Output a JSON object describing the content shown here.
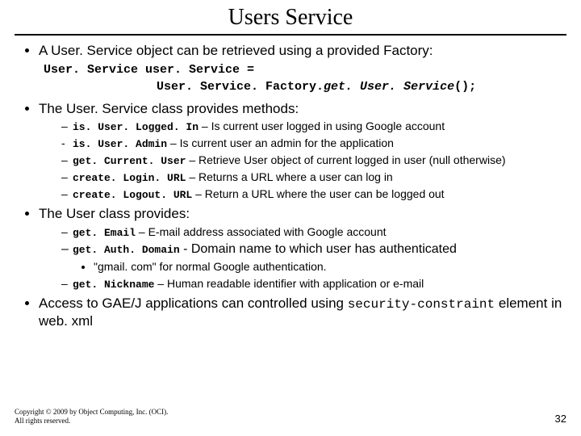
{
  "title": "Users Service",
  "bullets": {
    "b1": "A User. Service object can be retrieved using a provided Factory:",
    "code1_l1": "User. Service user. Service =",
    "code1_l2a": "User. Service. Factory.",
    "code1_l2b": "get. User. Service",
    "code1_l2c": "();",
    "b2": "The User. Service class provides methods:",
    "methods": [
      {
        "dash": "–",
        "name": "is. User. Logged. In",
        "desc": " – Is current user logged in using Google account"
      },
      {
        "dash": "-",
        "name": "is. User. Admin",
        "desc": " – Is current user an admin for the application"
      },
      {
        "dash": "–",
        "name": "get. Current. User",
        "desc": " – Retrieve User object of current logged in user (null otherwise)"
      },
      {
        "dash": "–",
        "name": "create. Login. URL",
        "desc": " – Returns a URL where a user can log in"
      },
      {
        "dash": "–",
        "name": "create. Logout. URL",
        "desc": " – Return a URL where the user can be logged out"
      }
    ],
    "b3": "The User class provides:",
    "user_methods": {
      "u1_dash": "–",
      "u1_name": "get. Email",
      "u1_desc": " – E-mail address associated with Google account",
      "u2_dash": "–",
      "u2_name": "get. Auth. Domain",
      "u2_desc": " - Domain name to which user has authenticated",
      "u2_sub": "\"gmail. com\" for normal Google authentication.",
      "u3_dash": "–",
      "u3_name": "get. Nickname",
      "u3_desc": " – Human readable identifier with application or e-mail"
    },
    "b4_pre": "Access to GAE/J applications can controlled using ",
    "b4_code": "security-constraint",
    "b4_post": " element in web. xml"
  },
  "footer": {
    "l1": "Copyright © 2009 by Object Computing, Inc. (OCI).",
    "l2": "All rights reserved."
  },
  "page": "32"
}
